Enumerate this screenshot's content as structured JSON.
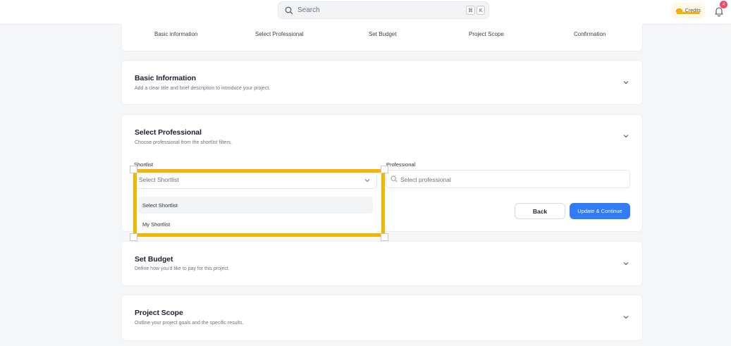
{
  "topbar": {
    "search_placeholder": "Search",
    "shortcut_keys": [
      "⌘",
      "K"
    ],
    "credits_label": "Credits",
    "notification_count": "4",
    "accent_color": "#f5b400"
  },
  "steps": [
    "Basic information",
    "Select Professional",
    "Set Budget",
    "Project Scope",
    "Confirmation"
  ],
  "sections": {
    "basic": {
      "title": "Basic Information",
      "subtitle": "Add a clear title and brief description to introduce your project."
    },
    "professional": {
      "title": "Select Professional",
      "subtitle": "Choose professional from the shortlist filters.",
      "shortlist_label": "Shortlist",
      "shortlist_value": "Select Shortlist",
      "shortlist_options": [
        "Select Shortlist",
        "My Shortlist"
      ],
      "professional_label": "Professional",
      "professional_placeholder": "Select professional",
      "back_label": "Back",
      "continue_label": "Update & Continue",
      "primary_color": "#2f7cf6"
    },
    "budget": {
      "title": "Set Budget",
      "subtitle": "Define how you'd like to pay for this project."
    },
    "scope": {
      "title": "Project Scope",
      "subtitle": "Outline your project goals and the specific results."
    }
  }
}
